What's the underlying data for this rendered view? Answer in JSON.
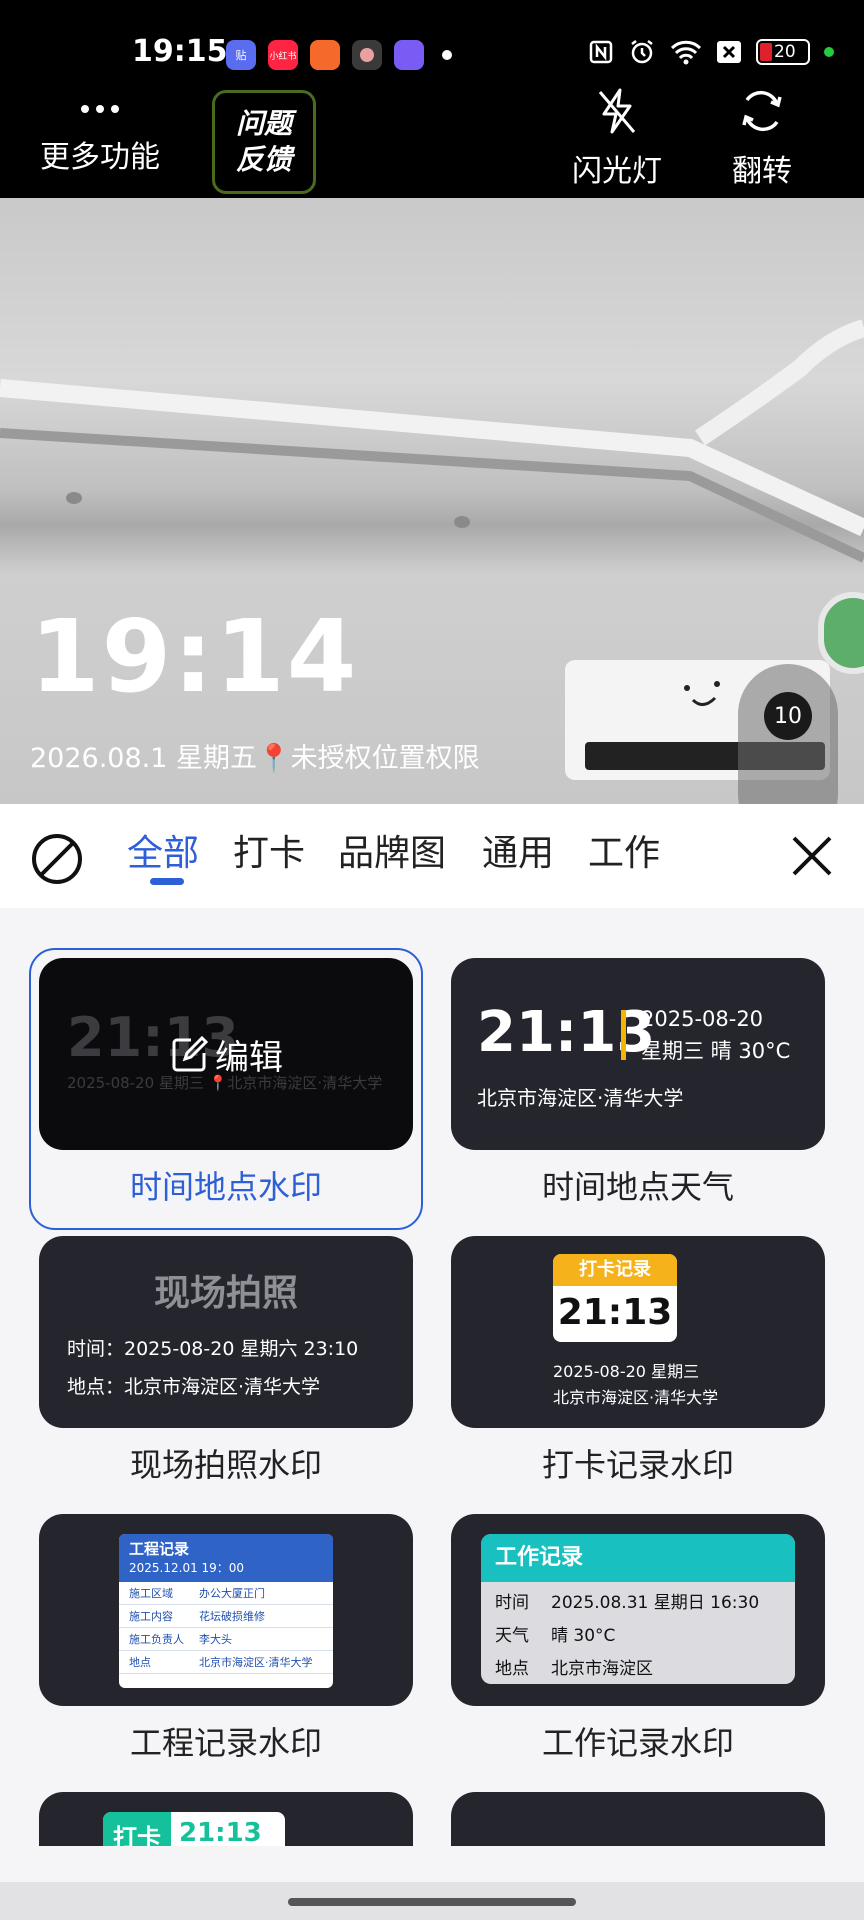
{
  "status_bar": {
    "time": "19:15",
    "apps": [
      {
        "name": "tieba",
        "label": "贴",
        "color": "#5a6cf0"
      },
      {
        "name": "xiaohongshu",
        "label": "小红书",
        "color": "#ff2442"
      },
      {
        "name": "app-orange",
        "label": "",
        "color": "#f56a2a"
      },
      {
        "name": "app-dark",
        "label": "",
        "color": "#3a3a3a"
      },
      {
        "name": "app-purple",
        "label": "",
        "color": "#7a5cf5"
      }
    ],
    "battery": "20"
  },
  "toolbar": {
    "more_label": "更多功能",
    "feedback_line1": "问题",
    "feedback_line2": "反馈",
    "flash_label": "闪光灯",
    "flip_label": "翻转"
  },
  "preview": {
    "watermark_time": "19:14",
    "watermark_info": "2026.08.1 星期五",
    "location_text": "未授权位置权限",
    "side_counter": "10"
  },
  "tabs": {
    "items": [
      "全部",
      "打卡",
      "品牌图",
      "通用",
      "工作"
    ],
    "active_index": 0
  },
  "templates": {
    "t1": {
      "label": "时间地点水印",
      "time": "21:13",
      "sub_date": "2025-08-20 星期三",
      "sub_loc": "北京市海淀区·清华大学",
      "edit_label": "编辑"
    },
    "t2": {
      "label": "时间地点天气",
      "time": "21:13",
      "date": "2025-08-20",
      "weather": "星期三 晴 30°C",
      "location": "北京市海淀区·清华大学"
    },
    "t3": {
      "label": "现场拍照水印",
      "heading": "现场拍照",
      "time_row": "时间：2025-08-20  星期六 23:10",
      "loc_row": "地点：北京市海淀区·清华大学"
    },
    "t4": {
      "label": "打卡记录水印",
      "badge": "打卡记录",
      "time": "21:13",
      "date": "2025-08-20 星期三",
      "location": "北京市海淀区·清华大学"
    },
    "t5": {
      "label": "工程记录水印",
      "title": "工程记录",
      "datetime": "2025.12.01 19：00",
      "rows": [
        {
          "k": "施工区域",
          "v": "办公大厦正门"
        },
        {
          "k": "施工内容",
          "v": "花坛破损维修"
        },
        {
          "k": "施工负责人",
          "v": "李大头"
        },
        {
          "k": "地点",
          "v": "北京市海淀区·清华大学"
        }
      ]
    },
    "t6": {
      "label": "工作记录水印",
      "title": "工作记录",
      "rows": [
        {
          "k": "时间",
          "v": "2025.08.31 星期日 16:30"
        },
        {
          "k": "天气",
          "v": "晴 30°C"
        },
        {
          "k": "地点",
          "v": "北京市海淀区"
        }
      ]
    },
    "t7": {
      "badge": "打卡",
      "time": "21:13"
    }
  }
}
